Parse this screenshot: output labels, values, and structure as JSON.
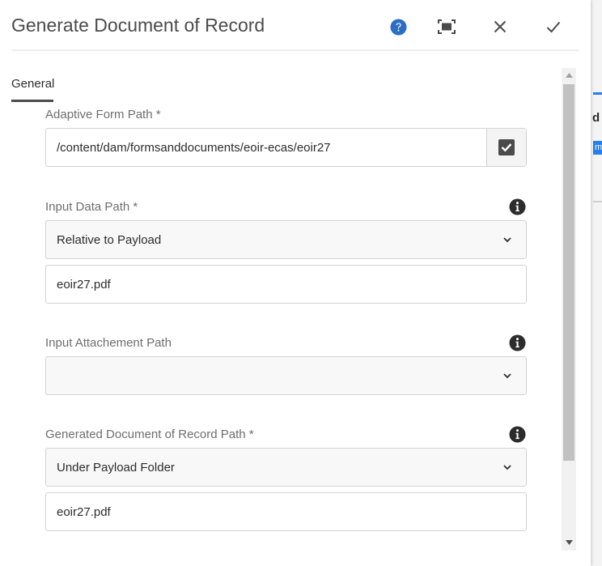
{
  "dialog": {
    "title": "Generate Document of Record",
    "icons": {
      "help": "help-circle-icon",
      "fullscreen": "fullscreen-icon",
      "close": "close-icon",
      "confirm": "checkmark-icon"
    }
  },
  "tabs": [
    {
      "label": "General",
      "active": true
    }
  ],
  "form": {
    "adaptive_form_path": {
      "label": "Adaptive Form Path *",
      "value": "/content/dam/formsanddocuments/eoir-ecas/eoir27"
    },
    "input_data_path": {
      "label": "Input Data Path *",
      "selected": "Relative to Payload",
      "value": "eoir27.pdf"
    },
    "input_attachment_path": {
      "label": "Input Attachement Path",
      "selected": ""
    },
    "generated_dor_path": {
      "label": "Generated Document of Record Path *",
      "selected": "Under Payload Folder",
      "value": "eoir27.pdf"
    }
  },
  "background": {
    "fragment_text": "d",
    "chip_text": "m"
  },
  "colors": {
    "accent": "#2c6ec4",
    "text": "#4b4b4b",
    "border": "#d3d3d3"
  }
}
